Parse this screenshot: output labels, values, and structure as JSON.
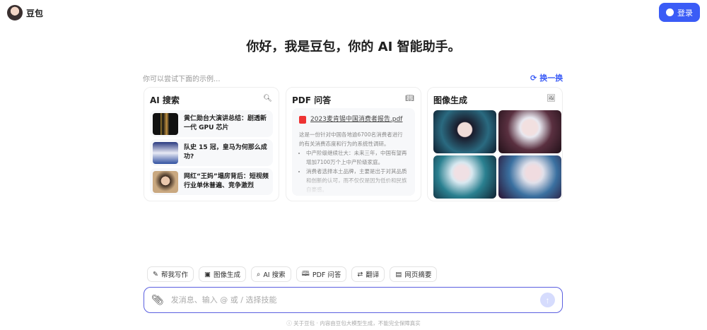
{
  "header": {
    "brand": "豆包",
    "login": "登录"
  },
  "title": "你好，我是豆包，你的 AI 智能助手。",
  "hint": "你可以尝试下面的示例...",
  "refresh": "换一换",
  "cards": {
    "ai_search": {
      "title": "AI 搜索",
      "items": [
        "黄仁勋台大演讲总结：剧透新一代 GPU 芯片",
        "队史 15 冠，皇马为何那么成功?",
        "网红“王妈”塌房背后：短视频行业单休普遍、竞争激烈"
      ]
    },
    "pdf": {
      "title": "PDF 问答",
      "file": "2023麦肯锡中国消费者报告.pdf",
      "summary": "这是一份针对中国各地逾6700名消费者进行的有关消费态度和行为的系统性调研。",
      "bullets": [
        "中产阶级继续壮大：未来三年，中国有望再增加7100万个上中产阶级家庭。",
        "消费者选择本土品牌，主要是出于对其品质和创新的认可，而不仅仅是因为低价和民族自豪感。"
      ]
    },
    "image": {
      "title": "图像生成"
    }
  },
  "chips": [
    "帮我写作",
    "图像生成",
    "AI 搜索",
    "PDF 问答",
    "翻译",
    "网页摘要"
  ],
  "input": {
    "placeholder": "发消息、输入 @ 或 / 选择技能"
  },
  "footer": {
    "about": "关于豆包",
    "disclaimer": "内容由豆包大模型生成，不能完全保障真实"
  }
}
